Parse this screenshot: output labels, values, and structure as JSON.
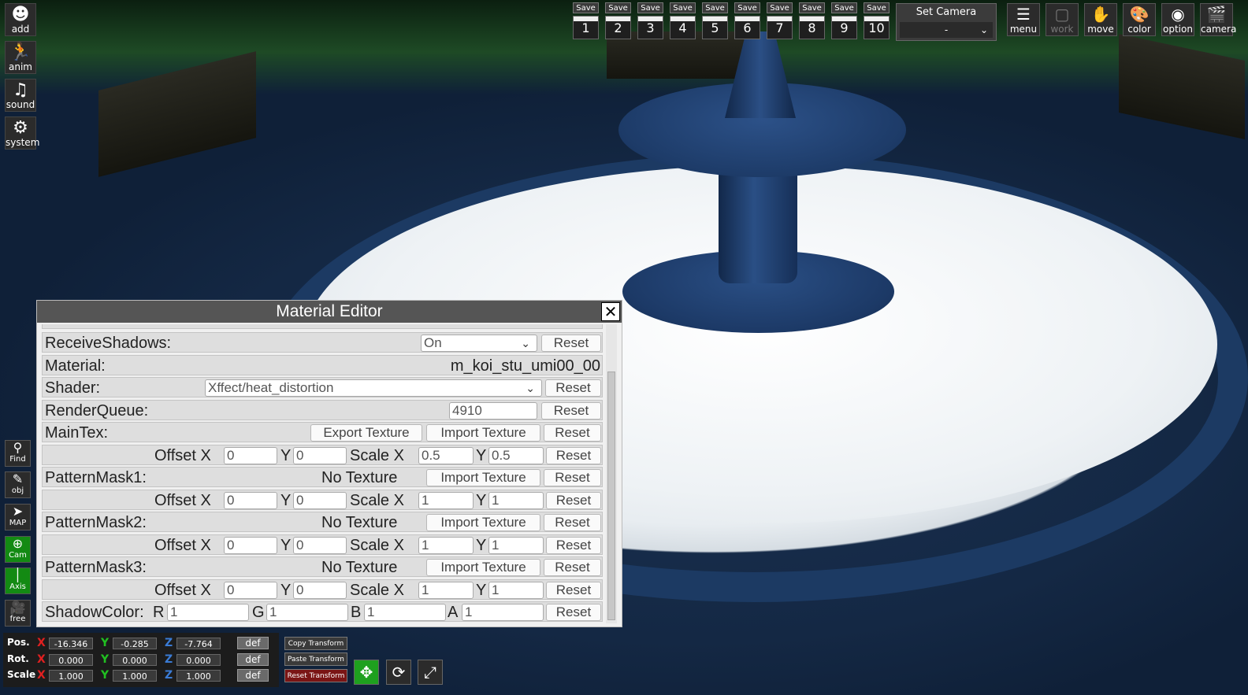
{
  "left_toolbar": [
    {
      "label": "add",
      "icon": "person-add-icon"
    },
    {
      "label": "anim",
      "icon": "running-person-icon"
    },
    {
      "label": "sound",
      "icon": "music-note-icon"
    },
    {
      "label": "system",
      "icon": "gears-icon"
    }
  ],
  "left_side_tools": [
    {
      "label": "Find",
      "icon": "magnifier-icon"
    },
    {
      "label": "obj",
      "icon": "edit-icon"
    },
    {
      "label": "MAP",
      "icon": "map-pointer-icon"
    },
    {
      "label": "Cam",
      "icon": "plus-circle-icon"
    },
    {
      "label": "Axis",
      "icon": "axis-icon"
    },
    {
      "label": "free",
      "icon": "movie-camera-icon"
    }
  ],
  "save_slots": {
    "label": "Save",
    "numbers": [
      "1",
      "2",
      "3",
      "4",
      "5",
      "6",
      "7",
      "8",
      "9",
      "10"
    ]
  },
  "set_camera": {
    "title": "Set Camera",
    "value": "-"
  },
  "top_right_buttons": [
    {
      "label": "menu",
      "icon": "menu-list-icon"
    },
    {
      "label": "work",
      "icon": "work-frame-icon"
    },
    {
      "label": "move",
      "icon": "hand-icon"
    },
    {
      "label": "color",
      "icon": "palette-icon"
    },
    {
      "label": "option",
      "icon": "eye-icon"
    },
    {
      "label": "camera",
      "icon": "clapper-icon"
    }
  ],
  "material_editor": {
    "title": "Material Editor",
    "receive_shadows": {
      "label": "ReceiveShadows:",
      "value": "On",
      "reset": "Reset"
    },
    "material": {
      "label": "Material:",
      "value": "m_koi_stu_umi00_00"
    },
    "shader": {
      "label": "Shader:",
      "value": "Xffect/heat_distortion",
      "reset": "Reset"
    },
    "render_queue": {
      "label": "RenderQueue:",
      "value": "4910",
      "reset": "Reset"
    },
    "maintex": {
      "label": "MainTex:",
      "export": "Export Texture",
      "import": "Import Texture",
      "reset": "Reset",
      "offset_label": "Offset X",
      "y_label": "Y",
      "scale_label": "Scale X",
      "offset_x": "0",
      "offset_y": "0",
      "scale_x": "0.5",
      "scale_y": "0.5"
    },
    "pattern_masks": [
      {
        "label": "PatternMask1:",
        "texture": "No Texture",
        "import": "Import Texture",
        "reset": "Reset",
        "offset_x": "0",
        "offset_y": "0",
        "scale_x": "1",
        "scale_y": "1"
      },
      {
        "label": "PatternMask2:",
        "texture": "No Texture",
        "import": "Import Texture",
        "reset": "Reset",
        "offset_x": "0",
        "offset_y": "0",
        "scale_x": "1",
        "scale_y": "1"
      },
      {
        "label": "PatternMask3:",
        "texture": "No Texture",
        "import": "Import Texture",
        "reset": "Reset",
        "offset_x": "0",
        "offset_y": "0",
        "scale_x": "1",
        "scale_y": "1"
      }
    ],
    "shadow_color": {
      "label": "ShadowColor:",
      "r_label": "R",
      "g_label": "G",
      "b_label": "B",
      "a_label": "A",
      "r": "1",
      "g": "1",
      "b": "1",
      "a": "1",
      "reset": "Reset"
    }
  },
  "transform": {
    "pos_label": "Pos.",
    "rot_label": "Rot.",
    "scale_label": "Scale",
    "x": "X",
    "y": "Y",
    "z": "Z",
    "def": "def",
    "pos": {
      "x": "-16.346",
      "y": "-0.285",
      "z": "-7.764"
    },
    "rot": {
      "x": "0.000",
      "y": "0.000",
      "z": "0.000"
    },
    "scale": {
      "x": "1.000",
      "y": "1.000",
      "z": "1.000"
    },
    "copy": "Copy Transform",
    "paste": "Paste Transform",
    "reset": "Reset Transform"
  }
}
